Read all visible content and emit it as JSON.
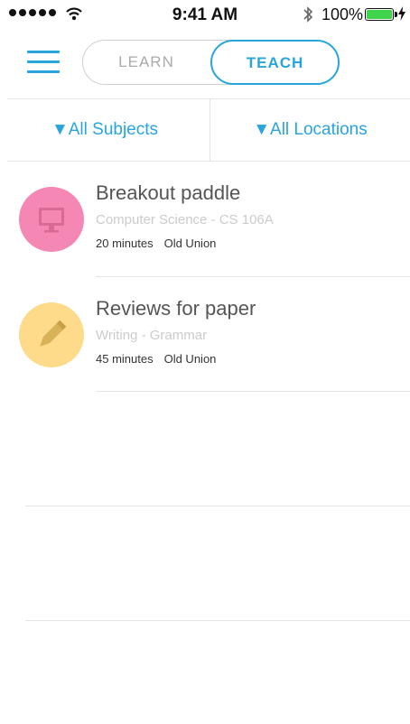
{
  "status_bar": {
    "time": "9:41 AM",
    "battery_percent": "100%",
    "icons": [
      "signal-dots-icon",
      "wifi-icon",
      "bluetooth-icon",
      "battery-icon",
      "charging-bolt-icon"
    ],
    "battery_fill_color": "#3fd44a"
  },
  "nav": {
    "menu_icon": "hamburger-menu-icon",
    "tabs": [
      {
        "label": "LEARN",
        "selected": false
      },
      {
        "label": "TEACH",
        "selected": true
      }
    ],
    "accent_color": "#27a5dc"
  },
  "filters": {
    "subjects": "▼All Subjects",
    "locations": "▼All Locations"
  },
  "items": [
    {
      "title": "Breakout paddle",
      "subtitle": "Computer Science - CS 106A",
      "duration": "20 minutes",
      "location": "Old Union",
      "icon": "monitor-icon",
      "icon_bg": "#f587b4"
    },
    {
      "title": "Reviews for paper",
      "subtitle": "Writing - Grammar",
      "duration": "45 minutes",
      "location": "Old Union",
      "icon": "pencil-icon",
      "icon_bg": "#fddb8b"
    }
  ]
}
